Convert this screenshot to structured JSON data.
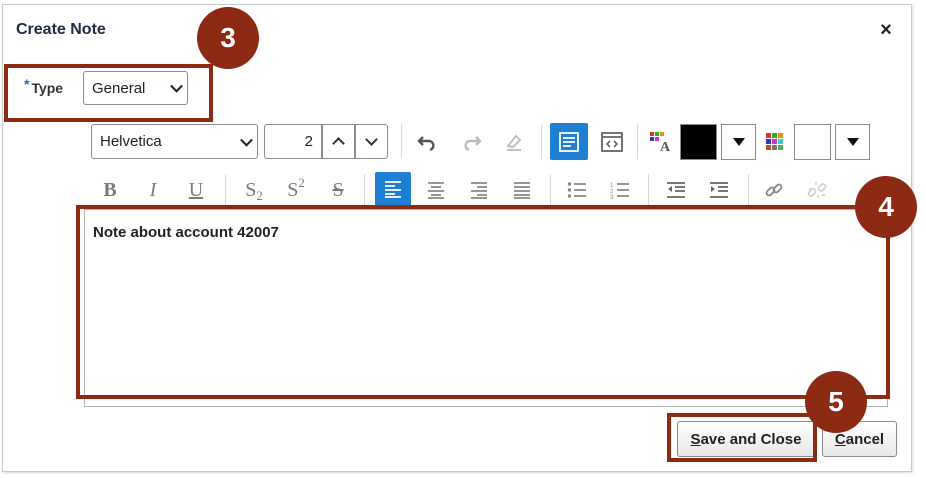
{
  "dialog": {
    "title": "Create Note",
    "close_label": "×"
  },
  "type_field": {
    "required_marker": "*",
    "label": "Type",
    "value": "General"
  },
  "toolbar": {
    "font_family": "Helvetica",
    "font_size": "2",
    "bold": "B",
    "italic": "I",
    "underline": "U",
    "subscript": "S",
    "subscript_digit": "2",
    "superscript": "S",
    "superscript_digit": "2",
    "strikethrough": "S",
    "text_color": "#000000",
    "background_color": "#ffffff",
    "active_color": "#1f7fd4"
  },
  "editor": {
    "content": "Note about account 42007"
  },
  "buttons": {
    "save_close_first": "S",
    "save_close_rest": "ave and Close",
    "cancel_first": "C",
    "cancel_rest": "ancel"
  },
  "callouts": {
    "type_step": "3",
    "editor_step": "4",
    "save_step": "5",
    "color": "#8c2a14"
  }
}
